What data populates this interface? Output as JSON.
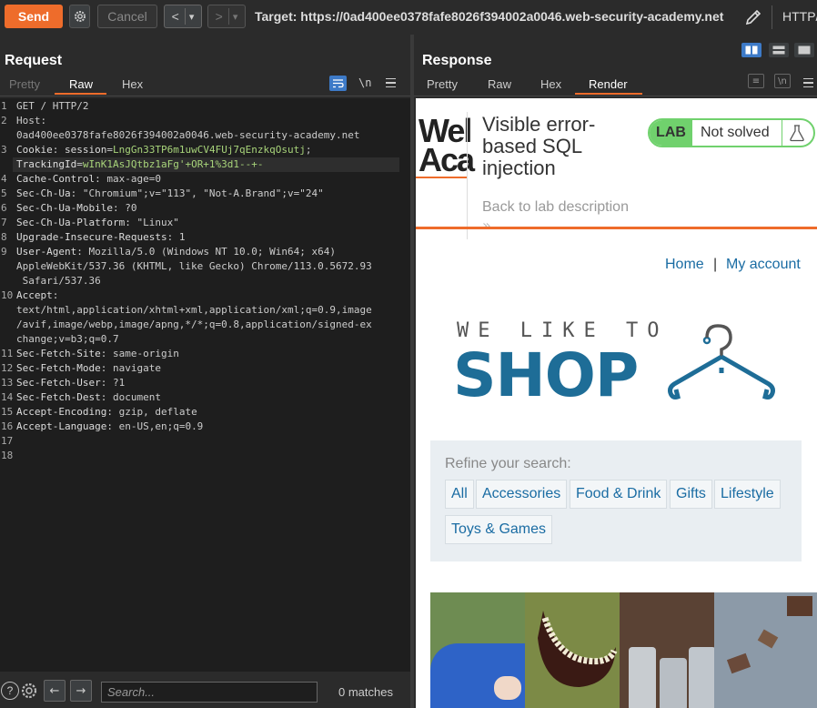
{
  "toolbar": {
    "send_label": "Send",
    "cancel_label": "Cancel",
    "back_label": "<",
    "back_dropdown": "▾",
    "forward_label": ">",
    "forward_dropdown": "▾",
    "target": "Target: https://0ad400ee0378fafe8026f394002a0046.web-security-academy.net",
    "protocol": "HTTP/"
  },
  "request": {
    "title": "Request",
    "tabs": [
      "Pretty",
      "Raw",
      "Hex"
    ],
    "active_tab": "Raw",
    "ln_toggle": "\\n",
    "lines": [
      {
        "n": "1",
        "text": "GET / HTTP/2"
      },
      {
        "n": "2",
        "text": "Host:"
      },
      {
        "n": "",
        "text": "0ad400ee0378fafe8026f394002a0046.web-security-academy.net"
      },
      {
        "n": "3",
        "key": "Cookie",
        "sep": ": ",
        "attr": "session",
        "eq": "=",
        "val": "LngGn33TP6m1uwCV4FUj7qEnzkqOsutj",
        "tail": ";"
      },
      {
        "n": "",
        "attr": "TrackingId",
        "eq": "=",
        "val": "wInK1AsJQtbz1aFg'+OR+1%3d1--+-"
      },
      {
        "n": "4",
        "key": "Cache-Control",
        "sep": ": ",
        "rest": "max-age=0"
      },
      {
        "n": "5",
        "key": "Sec-Ch-Ua",
        "sep": ": ",
        "rest": "\"Chromium\";v=\"113\", \"Not-A.Brand\";v=\"24\""
      },
      {
        "n": "6",
        "key": "Sec-Ch-Ua-Mobile",
        "sep": ": ",
        "rest": "?0"
      },
      {
        "n": "7",
        "key": "Sec-Ch-Ua-Platform",
        "sep": ": ",
        "rest": "\"Linux\""
      },
      {
        "n": "8",
        "key": "Upgrade-Insecure-Requests",
        "sep": ": ",
        "rest": "1"
      },
      {
        "n": "9",
        "key": "User-Agent",
        "sep": ": ",
        "rest": "Mozilla/5.0 (Windows NT 10.0; Win64; x64)"
      },
      {
        "n": "",
        "text": "AppleWebKit/537.36 (KHTML, like Gecko) Chrome/113.0.5672.93"
      },
      {
        "n": "",
        "text": " Safari/537.36"
      },
      {
        "n": "10",
        "key": "Accept",
        "sep": ":"
      },
      {
        "n": "",
        "text": "text/html,application/xhtml+xml,application/xml;q=0.9,image"
      },
      {
        "n": "",
        "text": "/avif,image/webp,image/apng,*/*;q=0.8,application/signed-ex"
      },
      {
        "n": "",
        "text": "change;v=b3;q=0.7"
      },
      {
        "n": "11",
        "key": "Sec-Fetch-Site",
        "sep": ": ",
        "rest": "same-origin"
      },
      {
        "n": "12",
        "key": "Sec-Fetch-Mode",
        "sep": ": ",
        "rest": "navigate"
      },
      {
        "n": "13",
        "key": "Sec-Fetch-User",
        "sep": ": ",
        "rest": "?1"
      },
      {
        "n": "14",
        "key": "Sec-Fetch-Dest",
        "sep": ": ",
        "rest": "document"
      },
      {
        "n": "15",
        "key": "Accept-Encoding",
        "sep": ": ",
        "rest": "gzip, deflate"
      },
      {
        "n": "16",
        "key": "Accept-Language",
        "sep": ": ",
        "rest": "en-US,en;q=0.9"
      },
      {
        "n": "17",
        "text": ""
      },
      {
        "n": "18",
        "text": ""
      }
    ],
    "search_placeholder": "Search...",
    "matches": "0 matches"
  },
  "response": {
    "title": "Response",
    "tabs": [
      "Pretty",
      "Raw",
      "Hex",
      "Render"
    ],
    "active_tab": "Render",
    "ln_toggle": "\\n",
    "page": {
      "logo_line1": "Wel",
      "logo_line2": "Aca",
      "lab_title": "Visible error-based SQL injection",
      "lab_badge": "LAB",
      "lab_status": "Not solved",
      "back_link": "Back to lab description",
      "back_chevrons": "»",
      "nav": [
        "Home",
        "|",
        "My account"
      ],
      "shop_tagline": "WE LIKE TO",
      "shop_word": "SHOP",
      "refine_label": "Refine your search:",
      "categories": [
        "All",
        "Accessories",
        "Food & Drink",
        "Gifts",
        "Lifestyle",
        "Toys & Games"
      ]
    }
  },
  "colors": {
    "accent": "#ee6c2b",
    "lab_green": "#70d16d",
    "link_blue": "#1a6ca3",
    "shop_blue": "#1e6d97"
  }
}
